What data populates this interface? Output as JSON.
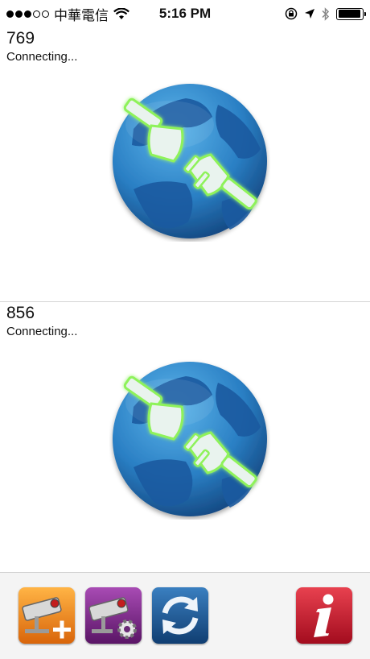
{
  "status_bar": {
    "carrier": "中華電信",
    "time": "5:16 PM",
    "signal_bars": 3,
    "signal_total": 5,
    "battery_level": 0.95
  },
  "cameras": [
    {
      "name": "769",
      "status": "Connecting..."
    },
    {
      "name": "856",
      "status": "Connecting..."
    }
  ],
  "toolbar": {
    "buttons": [
      {
        "icon": "add-camera-icon",
        "color": "#f08a1c"
      },
      {
        "icon": "camera-settings-icon",
        "color": "#7a2a86"
      },
      {
        "icon": "refresh-icon",
        "color": "#1f5c94"
      },
      {
        "icon": "info-icon",
        "color": "#c8102e"
      }
    ]
  },
  "colors": {
    "globe_ocean": "#2a7fc4",
    "globe_land": "#1d5ea6",
    "plug_glow": "#7df04a"
  }
}
